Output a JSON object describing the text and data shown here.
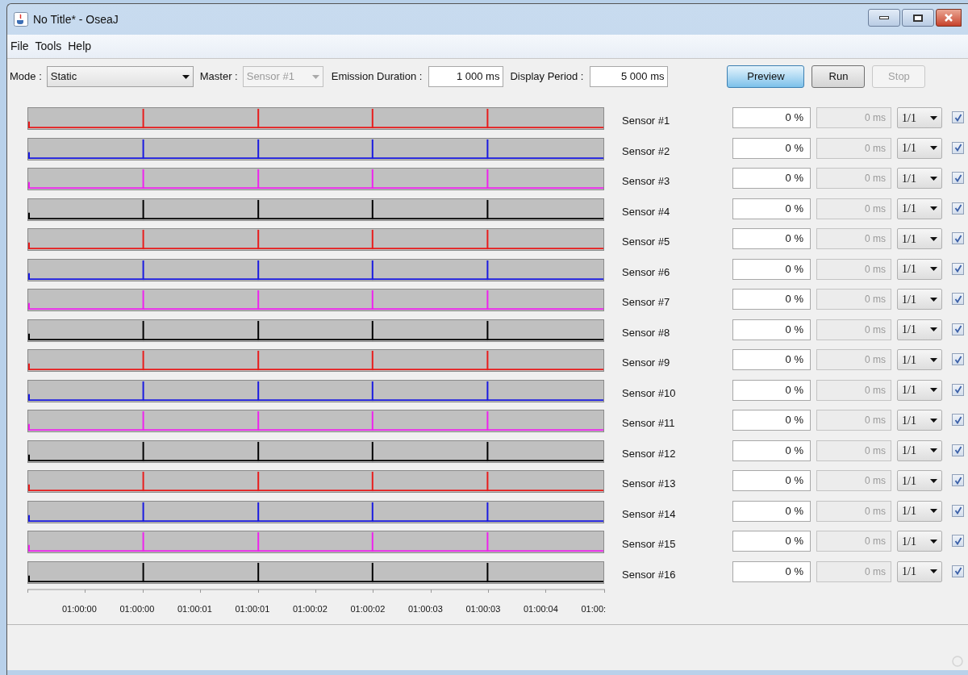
{
  "window": {
    "title": "No Title* - OseaJ"
  },
  "menu": [
    "File",
    "Tools",
    "Help"
  ],
  "toolbar": {
    "mode_label": "Mode :",
    "mode_value": "Static",
    "master_label": "Master :",
    "master_value": "Sensor #1",
    "master_disabled": true,
    "emission_label": "Emission Duration :",
    "emission_value": "1 000 ms",
    "period_label": "Display Period :",
    "period_value": "5 000 ms"
  },
  "buttons": [
    {
      "label": "Preview",
      "kind": "default",
      "disabled": false
    },
    {
      "label": "Run",
      "kind": "normal",
      "disabled": false
    },
    {
      "label": "Stop",
      "kind": "normal",
      "disabled": true
    }
  ],
  "sensors": [
    {
      "name": "Sensor #1",
      "color": "#e81c1c",
      "percent": "0 %",
      "delay": "0 ms",
      "ratio": "1/1",
      "checked": true
    },
    {
      "name": "Sensor #2",
      "color": "#1a1ae0",
      "percent": "0 %",
      "delay": "0 ms",
      "ratio": "1/1",
      "checked": true
    },
    {
      "name": "Sensor #3",
      "color": "#ee22ee",
      "percent": "0 %",
      "delay": "0 ms",
      "ratio": "1/1",
      "checked": true
    },
    {
      "name": "Sensor #4",
      "color": "#000000",
      "percent": "0 %",
      "delay": "0 ms",
      "ratio": "1/1",
      "checked": true
    },
    {
      "name": "Sensor #5",
      "color": "#e81c1c",
      "percent": "0 %",
      "delay": "0 ms",
      "ratio": "1/1",
      "checked": true
    },
    {
      "name": "Sensor #6",
      "color": "#1a1ae0",
      "percent": "0 %",
      "delay": "0 ms",
      "ratio": "1/1",
      "checked": true
    },
    {
      "name": "Sensor #7",
      "color": "#ee22ee",
      "percent": "0 %",
      "delay": "0 ms",
      "ratio": "1/1",
      "checked": true
    },
    {
      "name": "Sensor #8",
      "color": "#000000",
      "percent": "0 %",
      "delay": "0 ms",
      "ratio": "1/1",
      "checked": true
    },
    {
      "name": "Sensor #9",
      "color": "#e81c1c",
      "percent": "0 %",
      "delay": "0 ms",
      "ratio": "1/1",
      "checked": true
    },
    {
      "name": "Sensor #10",
      "color": "#1a1ae0",
      "percent": "0 %",
      "delay": "0 ms",
      "ratio": "1/1",
      "checked": true
    },
    {
      "name": "Sensor #11",
      "color": "#ee22ee",
      "percent": "0 %",
      "delay": "0 ms",
      "ratio": "1/1",
      "checked": true
    },
    {
      "name": "Sensor #12",
      "color": "#000000",
      "percent": "0 %",
      "delay": "0 ms",
      "ratio": "1/1",
      "checked": true
    },
    {
      "name": "Sensor #13",
      "color": "#e81c1c",
      "percent": "0 %",
      "delay": "0 ms",
      "ratio": "1/1",
      "checked": true
    },
    {
      "name": "Sensor #14",
      "color": "#1a1ae0",
      "percent": "0 %",
      "delay": "0 ms",
      "ratio": "1/1",
      "checked": true
    },
    {
      "name": "Sensor #15",
      "color": "#ee22ee",
      "percent": "0 %",
      "delay": "0 ms",
      "ratio": "1/1",
      "checked": true
    },
    {
      "name": "Sensor #16",
      "color": "#000000",
      "percent": "0 %",
      "delay": "0 ms",
      "ratio": "1/1",
      "checked": true
    }
  ],
  "time_axis": [
    "01:00:00",
    "01:00:00",
    "01:00:01",
    "01:00:01",
    "01:00:02",
    "01:00:02",
    "01:00:03",
    "01:00:03",
    "01:00:04",
    "01:00:"
  ]
}
